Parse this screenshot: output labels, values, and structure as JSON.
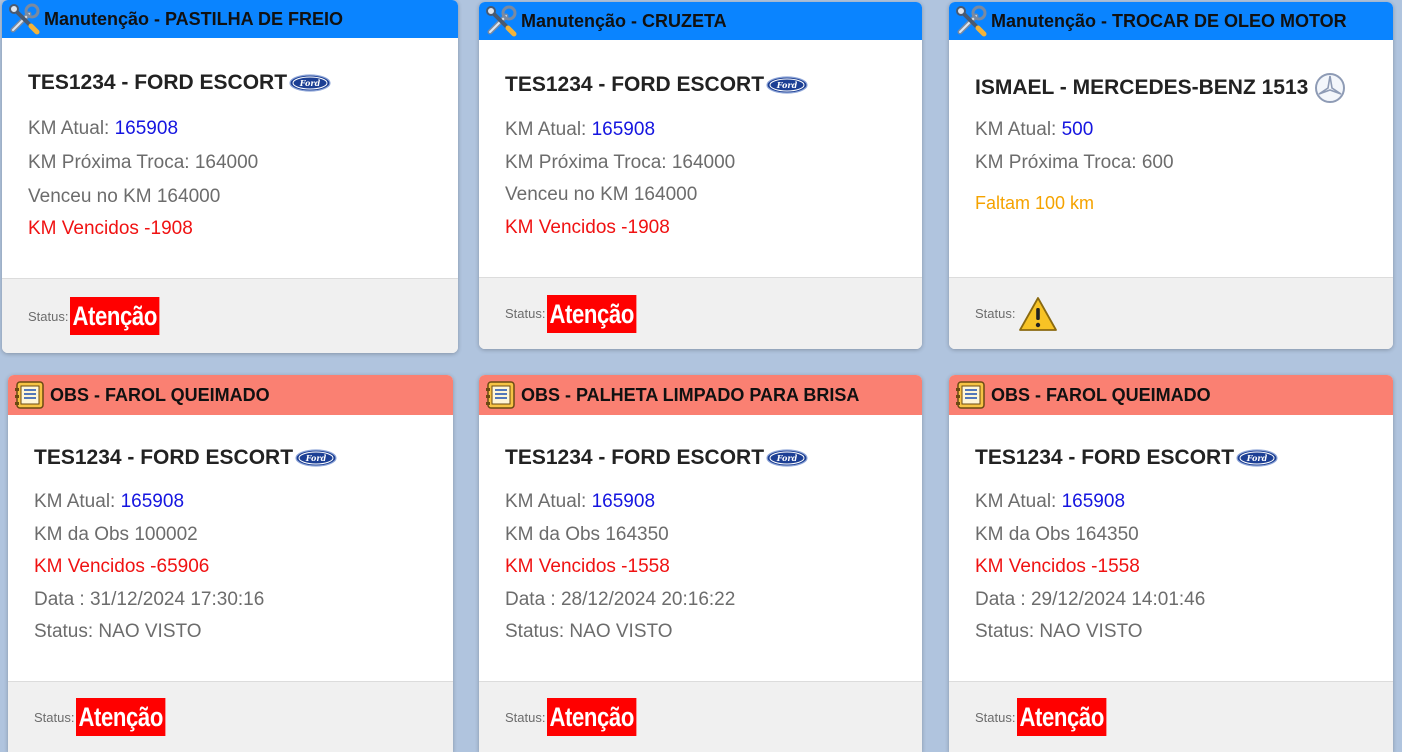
{
  "cards": [
    {
      "header": "Manutenção - PASTILHA DE FREIO",
      "vehicle": "TES1234 - FORD ESCORT",
      "brand_icon": "ford-logo-icon",
      "km_atual_label": "KM Atual: ",
      "km_atual_value": "165908",
      "line2": "KM Próxima Troca: 164000",
      "line3": "Venceu no KM 164000",
      "line4": "KM Vencidos -1908",
      "status_label": "Status:",
      "status_badge": "Atenção"
    },
    {
      "header": "Manutenção - CRUZETA",
      "vehicle": "TES1234 - FORD ESCORT",
      "brand_icon": "ford-logo-icon",
      "km_atual_label": "KM Atual: ",
      "km_atual_value": "165908",
      "line2": "KM Próxima Troca: 164000",
      "line3": "Venceu no KM 164000",
      "line4": "KM Vencidos -1908",
      "status_label": "Status:",
      "status_badge": "Atenção"
    },
    {
      "header": "Manutenção - TROCAR DE OLEO MOTOR",
      "vehicle": "ISMAEL - MERCEDES-BENZ 1513",
      "brand_icon": "mercedes-logo-icon",
      "km_atual_label": "KM Atual: ",
      "km_atual_value": "500",
      "line2": "KM Próxima Troca: 600",
      "line3": "Faltam 100 km",
      "status_label": "Status:",
      "status_icon": "warning-icon"
    },
    {
      "header": "OBS - FAROL QUEIMADO",
      "vehicle": "TES1234 - FORD ESCORT",
      "brand_icon": "ford-logo-icon",
      "km_atual_label": "KM Atual: ",
      "km_atual_value": "165908",
      "line2": "KM da Obs 100002",
      "line3": "KM Vencidos -65906",
      "line4": "Data : 31/12/2024 17:30:16",
      "line5": "Status: NAO VISTO",
      "status_label": "Status:",
      "status_badge": "Atenção"
    },
    {
      "header": "OBS - PALHETA LIMPADO PARA BRISA",
      "vehicle": "TES1234 - FORD ESCORT",
      "brand_icon": "ford-logo-icon",
      "km_atual_label": "KM Atual: ",
      "km_atual_value": "165908",
      "line2": "KM da Obs 164350",
      "line3": "KM Vencidos -1558",
      "line4": "Data : 28/12/2024 20:16:22",
      "line5": "Status: NAO VISTO",
      "status_label": "Status:",
      "status_badge": "Atenção"
    },
    {
      "header": "OBS - FAROL QUEIMADO",
      "vehicle": "TES1234 - FORD ESCORT",
      "brand_icon": "ford-logo-icon",
      "km_atual_label": "KM Atual: ",
      "km_atual_value": "165908",
      "line2": "KM da Obs 164350",
      "line3": "KM Vencidos -1558",
      "line4": "Data : 29/12/2024 14:01:46",
      "line5": "Status: NAO VISTO",
      "status_label": "Status:",
      "status_badge": "Atenção"
    }
  ],
  "colors": {
    "background": "#b0c4de",
    "maintenance_header": "#0a84ff",
    "obs_header": "#fa8072",
    "km_value": "#1515e0",
    "overdue": "#f01212",
    "pending": "#f5a300",
    "badge": "#ff0000"
  }
}
